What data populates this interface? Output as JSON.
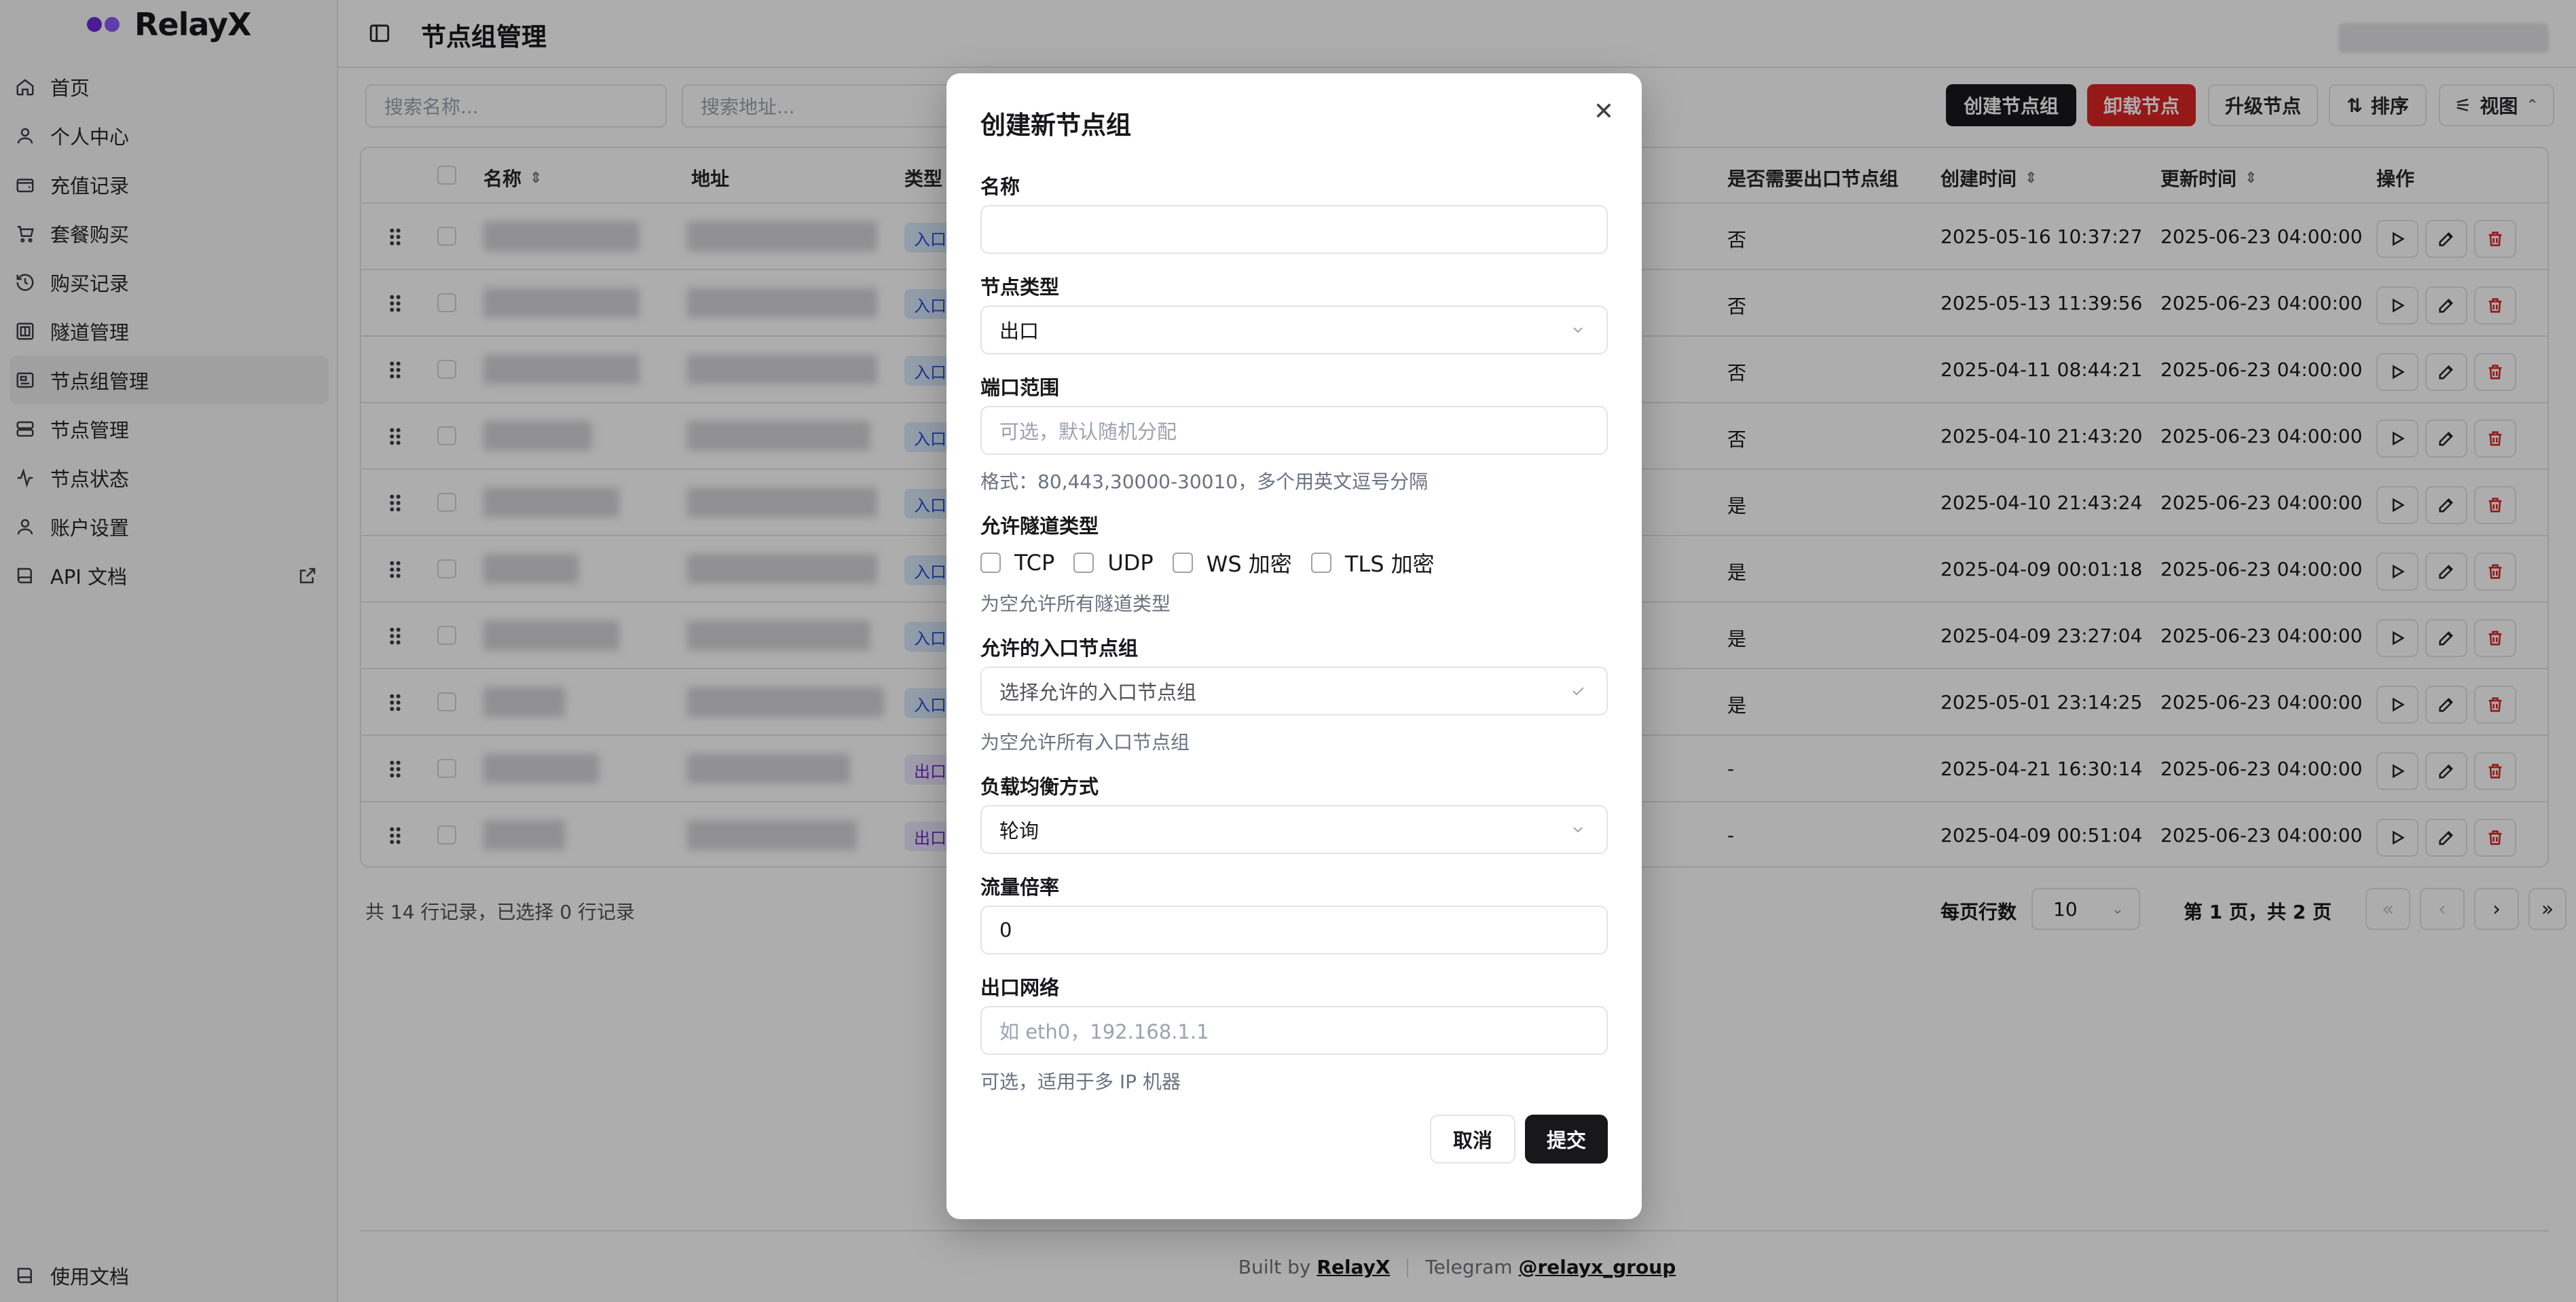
{
  "brand": {
    "name": "RelayX"
  },
  "sidebar": {
    "items": [
      {
        "label": "首页",
        "icon": "home-icon"
      },
      {
        "label": "个人中心",
        "icon": "user-icon"
      },
      {
        "label": "充值记录",
        "icon": "wallet-icon"
      },
      {
        "label": "套餐购买",
        "icon": "cart-icon"
      },
      {
        "label": "购买记录",
        "icon": "history-icon"
      },
      {
        "label": "隧道管理",
        "icon": "tunnel-icon"
      },
      {
        "label": "节点组管理",
        "icon": "node-group-icon",
        "active": true
      },
      {
        "label": "节点管理",
        "icon": "server-icon"
      },
      {
        "label": "节点状态",
        "icon": "activity-icon"
      },
      {
        "label": "账户设置",
        "icon": "user-cog-icon"
      },
      {
        "label": "API 文档",
        "icon": "book-icon"
      }
    ],
    "footer_label": "使用文档"
  },
  "header": {
    "title": "节点组管理"
  },
  "toolbar": {
    "search_name_placeholder": "搜索名称...",
    "search_address_placeholder": "搜索地址...",
    "create_label": "创建节点组",
    "uninstall_label": "卸载节点",
    "upgrade_label": "升级节点",
    "sort_label": "排序",
    "view_label": "视图"
  },
  "table": {
    "columns": {
      "name": "名称",
      "address": "地址",
      "type": "类型",
      "need_exit": "是否需要出口节点组",
      "created": "创建时间",
      "updated": "更新时间",
      "actions": "操作"
    },
    "rows": [
      {
        "type": "入口",
        "need_exit": "否",
        "created": "2025-05-16 10:37:27",
        "updated": "2025-06-23 04:00:00"
      },
      {
        "type": "入口",
        "need_exit": "否",
        "created": "2025-05-13 11:39:56",
        "updated": "2025-06-23 04:00:00"
      },
      {
        "type": "入口",
        "need_exit": "否",
        "created": "2025-04-11 08:44:21",
        "updated": "2025-06-23 04:00:00"
      },
      {
        "type": "入口",
        "need_exit": "否",
        "created": "2025-04-10 21:43:20",
        "updated": "2025-06-23 04:00:00"
      },
      {
        "type": "入口",
        "need_exit": "是",
        "created": "2025-04-10 21:43:24",
        "updated": "2025-06-23 04:00:00"
      },
      {
        "type": "入口",
        "need_exit": "是",
        "created": "2025-04-09 00:01:18",
        "updated": "2025-06-23 04:00:00"
      },
      {
        "type": "入口",
        "need_exit": "是",
        "created": "2025-04-09 23:27:04",
        "updated": "2025-06-23 04:00:00"
      },
      {
        "type": "入口",
        "need_exit": "是",
        "created": "2025-05-01 23:14:25",
        "updated": "2025-06-23 04:00:00"
      },
      {
        "type": "出口",
        "need_exit": "-",
        "created": "2025-04-21 16:30:14",
        "updated": "2025-06-23 04:00:00"
      },
      {
        "type": "出口",
        "need_exit": "-",
        "created": "2025-04-09 00:51:04",
        "updated": "2025-06-23 04:00:00"
      }
    ],
    "summary": "共 14 行记录，已选择 0 行记录",
    "rows_per_page_label": "每页行数",
    "rows_per_page_value": "10",
    "page_info": "第 1 页，共 2 页"
  },
  "footer": {
    "built_by_prefix": "Built by",
    "built_by": "RelayX",
    "telegram_prefix": "Telegram",
    "telegram": "@relayx_group"
  },
  "modal": {
    "title": "创建新节点组",
    "name_label": "名称",
    "name_value": "",
    "node_type_label": "节点类型",
    "node_type_value": "出口",
    "port_range_label": "端口范围",
    "port_range_placeholder": "可选，默认随机分配",
    "port_range_hint": "格式：80,443,30000-30010，多个用英文逗号分隔",
    "tunnel_types_label": "允许隧道类型",
    "tunnel_types": [
      "TCP",
      "UDP",
      "WS 加密",
      "TLS 加密"
    ],
    "tunnel_types_hint": "为空允许所有隧道类型",
    "entry_groups_label": "允许的入口节点组",
    "entry_groups_placeholder": "选择允许的入口节点组",
    "entry_groups_hint": "为空允许所有入口节点组",
    "lb_label": "负载均衡方式",
    "lb_value": "轮询",
    "traffic_label": "流量倍率",
    "traffic_value": "0",
    "exit_network_label": "出口网络",
    "exit_network_placeholder": "如 eth0，192.168.1.1",
    "exit_network_hint": "可选，适用于多 IP 机器",
    "cancel_label": "取消",
    "submit_label": "提交"
  },
  "colors": {
    "primary": "#18181b",
    "danger": "#dc2626",
    "border": "#e4e4e7",
    "entry_badge": "#dbeafe",
    "exit_badge": "#ede9fe"
  }
}
